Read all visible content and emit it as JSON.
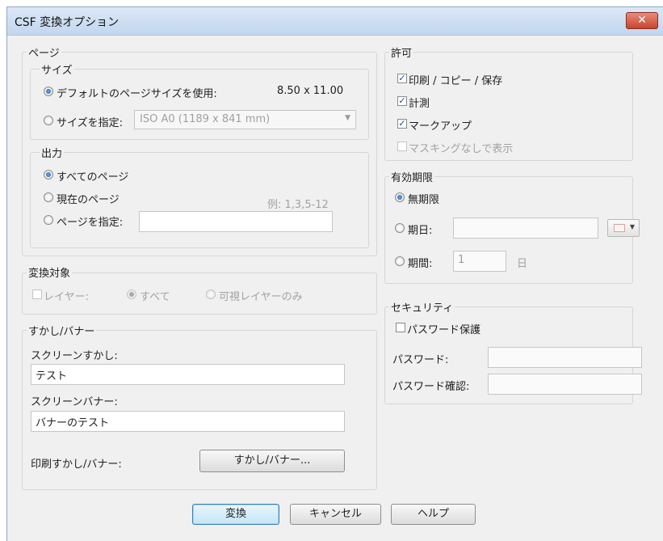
{
  "window": {
    "title": "CSF 変換オプション",
    "close_symbol": "✕"
  },
  "page": {
    "label": "ページ",
    "size": {
      "label": "サイズ",
      "default_label": "デフォルトのページサイズを使用:",
      "default_value": "8.50 x 11.00",
      "custom_label": "サイズを指定:",
      "custom_select": "ISO A0 (1189 x 841 mm)"
    },
    "output": {
      "label": "出力",
      "all_label": "すべてのページ",
      "current_label": "現在のページ",
      "example_hint": "例: 1,3,5-12",
      "specify_label": "ページを指定:",
      "specify_value": ""
    }
  },
  "permissions": {
    "label": "許可",
    "print_copy_save": "印刷 / コピー / 保存",
    "measure": "計測",
    "markup": "マークアップ",
    "no_masking": "マスキングなしで表示"
  },
  "expiration": {
    "label": "有効期限",
    "unlimited": "無期限",
    "date_label": "期日:",
    "date_value": "",
    "period_label": "期間:",
    "period_value": "1",
    "period_unit": "日"
  },
  "convert_target": {
    "label": "変換対象",
    "layers_label": "レイヤー:",
    "all_label": "すべて",
    "visible_only_label": "可視レイヤーのみ"
  },
  "security": {
    "label": "セキュリティ",
    "password_protect": "パスワード保護",
    "password_label": "パスワード:",
    "confirm_label": "パスワード確認:"
  },
  "watermark": {
    "label": "すかし/バナー",
    "screen_watermark_label": "スクリーンすかし:",
    "screen_watermark_value": "テスト",
    "screen_banner_label": "スクリーンバナー:",
    "screen_banner_value": "バナーのテスト",
    "print_label": "印刷すかし/バナー:",
    "print_button": "すかし/バナー..."
  },
  "buttons": {
    "convert": "変換",
    "cancel": "キャンセル",
    "help": "ヘルプ"
  },
  "state": {
    "size_mode": "default",
    "output_mode": "all",
    "print_copy_save_checked": true,
    "measure_checked": true,
    "markup_checked": true,
    "no_masking_checked": false,
    "expiration_mode": "unlimited",
    "layers_checked": false,
    "layers_mode": "all",
    "password_protect_checked": false
  },
  "colors": {
    "accent": "#3c7fb1",
    "close": "#c8452f"
  },
  "icons": {
    "date_picker": "calendar-icon",
    "close": "close-icon"
  }
}
